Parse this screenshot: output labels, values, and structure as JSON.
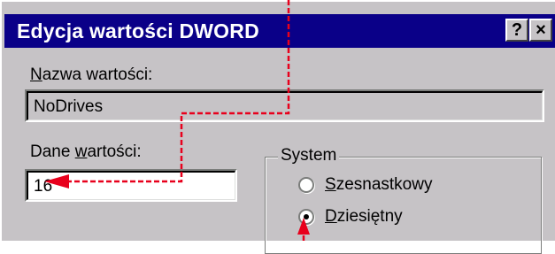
{
  "dialog": {
    "title": "Edycja wartości DWORD",
    "help_button": "?",
    "close_button": "×"
  },
  "value_name": {
    "label_first": "N",
    "label_rest": "azwa wartości:",
    "value": "NoDrives"
  },
  "value_data": {
    "label_before": "Dane ",
    "label_ul": "w",
    "label_after": "artości:",
    "value": "16"
  },
  "system": {
    "label": "System",
    "options": [
      {
        "first": "S",
        "rest": "zesnastkowy",
        "selected": false
      },
      {
        "first": "D",
        "rest": "ziesiętny",
        "selected": true
      }
    ]
  },
  "colors": {
    "title_bar": "#0a0088",
    "face": "#c6c3c6",
    "annotation": "#e8001c"
  }
}
